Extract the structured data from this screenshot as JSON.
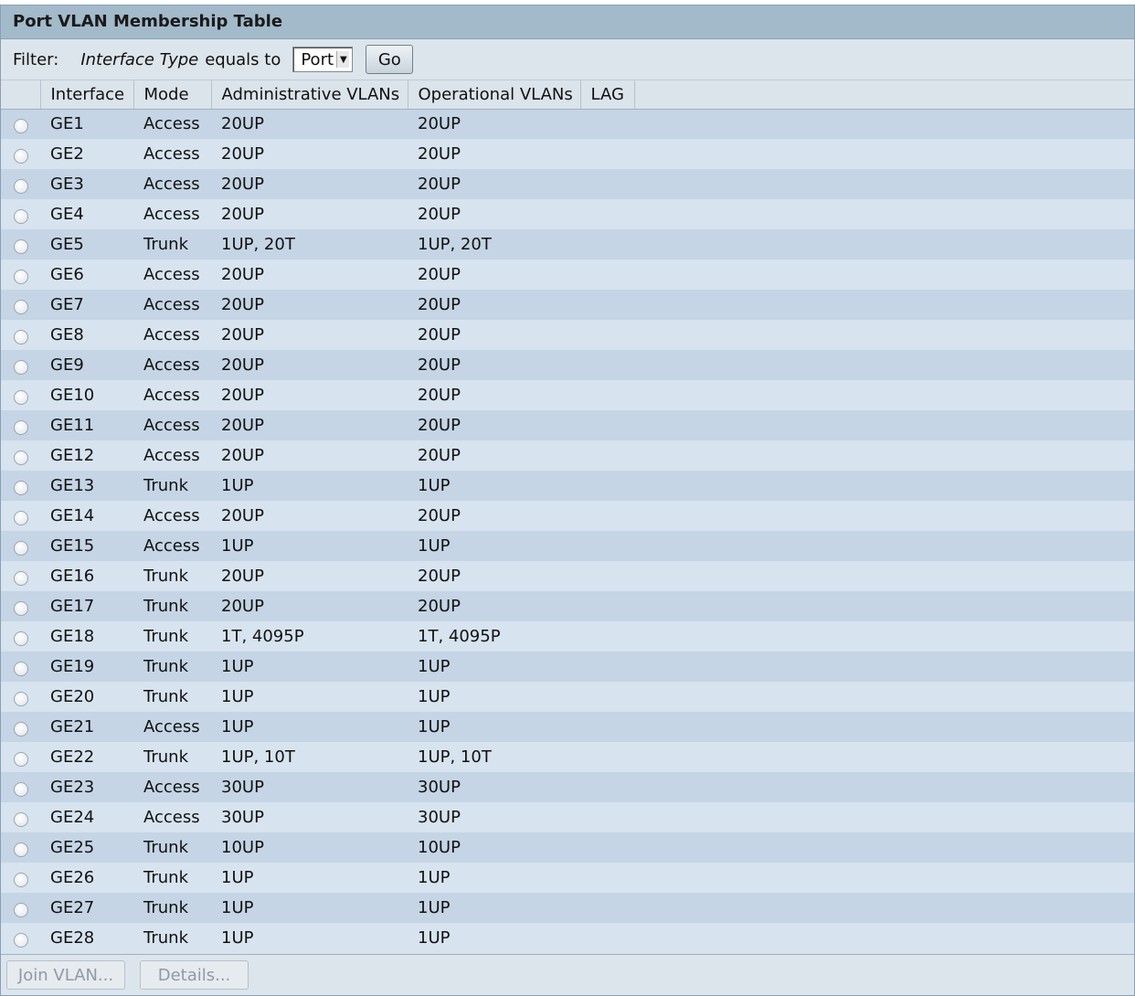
{
  "title": "Port VLAN Membership Table",
  "filter": {
    "label": "Filter:",
    "field": "Interface Type",
    "operator": "equals to",
    "selected": "Port",
    "go_label": "Go"
  },
  "columns": [
    "Interface",
    "Mode",
    "Administrative VLANs",
    "Operational VLANs",
    "LAG"
  ],
  "rows": [
    {
      "iface": "GE1",
      "mode": "Access",
      "admin": "20UP",
      "oper": "20UP",
      "lag": ""
    },
    {
      "iface": "GE2",
      "mode": "Access",
      "admin": "20UP",
      "oper": "20UP",
      "lag": ""
    },
    {
      "iface": "GE3",
      "mode": "Access",
      "admin": "20UP",
      "oper": "20UP",
      "lag": ""
    },
    {
      "iface": "GE4",
      "mode": "Access",
      "admin": "20UP",
      "oper": "20UP",
      "lag": ""
    },
    {
      "iface": "GE5",
      "mode": "Trunk",
      "admin": "1UP, 20T",
      "oper": "1UP, 20T",
      "lag": ""
    },
    {
      "iface": "GE6",
      "mode": "Access",
      "admin": "20UP",
      "oper": "20UP",
      "lag": ""
    },
    {
      "iface": "GE7",
      "mode": "Access",
      "admin": "20UP",
      "oper": "20UP",
      "lag": ""
    },
    {
      "iface": "GE8",
      "mode": "Access",
      "admin": "20UP",
      "oper": "20UP",
      "lag": ""
    },
    {
      "iface": "GE9",
      "mode": "Access",
      "admin": "20UP",
      "oper": "20UP",
      "lag": ""
    },
    {
      "iface": "GE10",
      "mode": "Access",
      "admin": "20UP",
      "oper": "20UP",
      "lag": ""
    },
    {
      "iface": "GE11",
      "mode": "Access",
      "admin": "20UP",
      "oper": "20UP",
      "lag": ""
    },
    {
      "iface": "GE12",
      "mode": "Access",
      "admin": "20UP",
      "oper": "20UP",
      "lag": ""
    },
    {
      "iface": "GE13",
      "mode": "Trunk",
      "admin": "1UP",
      "oper": "1UP",
      "lag": ""
    },
    {
      "iface": "GE14",
      "mode": "Access",
      "admin": "20UP",
      "oper": "20UP",
      "lag": ""
    },
    {
      "iface": "GE15",
      "mode": "Access",
      "admin": "1UP",
      "oper": "1UP",
      "lag": ""
    },
    {
      "iface": "GE16",
      "mode": "Trunk",
      "admin": "20UP",
      "oper": "20UP",
      "lag": ""
    },
    {
      "iface": "GE17",
      "mode": "Trunk",
      "admin": "20UP",
      "oper": "20UP",
      "lag": ""
    },
    {
      "iface": "GE18",
      "mode": "Trunk",
      "admin": "1T, 4095P",
      "oper": "1T, 4095P",
      "lag": ""
    },
    {
      "iface": "GE19",
      "mode": "Trunk",
      "admin": "1UP",
      "oper": "1UP",
      "lag": ""
    },
    {
      "iface": "GE20",
      "mode": "Trunk",
      "admin": "1UP",
      "oper": "1UP",
      "lag": ""
    },
    {
      "iface": "GE21",
      "mode": "Access",
      "admin": "1UP",
      "oper": "1UP",
      "lag": ""
    },
    {
      "iface": "GE22",
      "mode": "Trunk",
      "admin": "1UP, 10T",
      "oper": "1UP, 10T",
      "lag": ""
    },
    {
      "iface": "GE23",
      "mode": "Access",
      "admin": "30UP",
      "oper": "30UP",
      "lag": ""
    },
    {
      "iface": "GE24",
      "mode": "Access",
      "admin": "30UP",
      "oper": "30UP",
      "lag": ""
    },
    {
      "iface": "GE25",
      "mode": "Trunk",
      "admin": "10UP",
      "oper": "10UP",
      "lag": ""
    },
    {
      "iface": "GE26",
      "mode": "Trunk",
      "admin": "1UP",
      "oper": "1UP",
      "lag": ""
    },
    {
      "iface": "GE27",
      "mode": "Trunk",
      "admin": "1UP",
      "oper": "1UP",
      "lag": ""
    },
    {
      "iface": "GE28",
      "mode": "Trunk",
      "admin": "1UP",
      "oper": "1UP",
      "lag": ""
    }
  ],
  "footer": {
    "join_label": "Join VLAN...",
    "details_label": "Details..."
  }
}
